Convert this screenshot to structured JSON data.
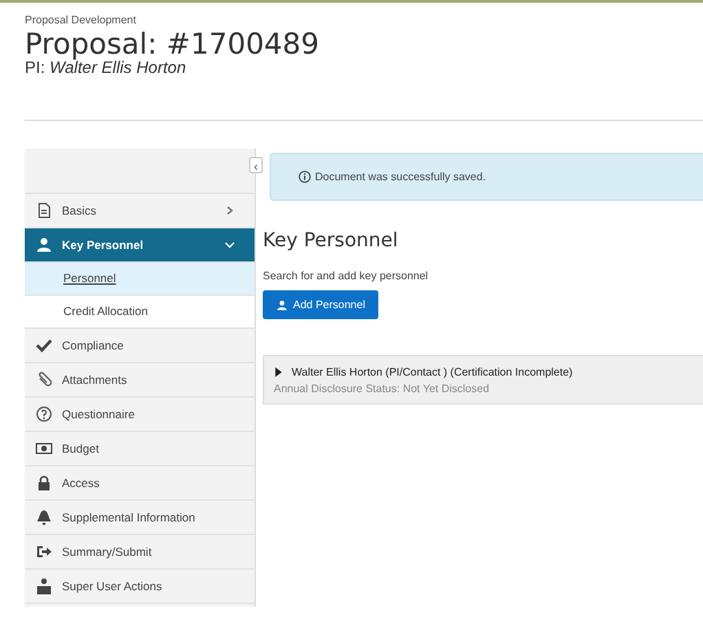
{
  "header": {
    "breadcrumb": "Proposal Development",
    "title": "Proposal: #1700489",
    "pi_label": "PI:",
    "pi_name": "Walter Ellis Horton"
  },
  "sidebar": {
    "collapse_glyph": "‹",
    "items": [
      {
        "label": "Basics",
        "selected": false,
        "expanded": false
      },
      {
        "label": "Key Personnel",
        "selected": true,
        "expanded": true,
        "children": [
          {
            "label": "Personnel",
            "selected": true
          },
          {
            "label": "Credit Allocation",
            "selected": false
          }
        ]
      },
      {
        "label": "Compliance",
        "selected": false
      },
      {
        "label": "Attachments",
        "selected": false
      },
      {
        "label": "Questionnaire",
        "selected": false
      },
      {
        "label": "Budget",
        "selected": false
      },
      {
        "label": "Access",
        "selected": false
      },
      {
        "label": "Supplemental Information",
        "selected": false
      },
      {
        "label": "Summary/Submit",
        "selected": false
      },
      {
        "label": "Super User Actions",
        "selected": false
      }
    ]
  },
  "alert": {
    "message": "Document was successfully saved."
  },
  "main": {
    "heading": "Key Personnel",
    "instruction": "Search for and add key personnel",
    "add_button": "Add Personnel",
    "persons": [
      {
        "name": "Walter Ellis Horton (PI/Contact ) (Certification Incomplete)",
        "disclosure": "Annual Disclosure Status: Not Yet Disclosed",
        "expanded": false
      }
    ]
  }
}
